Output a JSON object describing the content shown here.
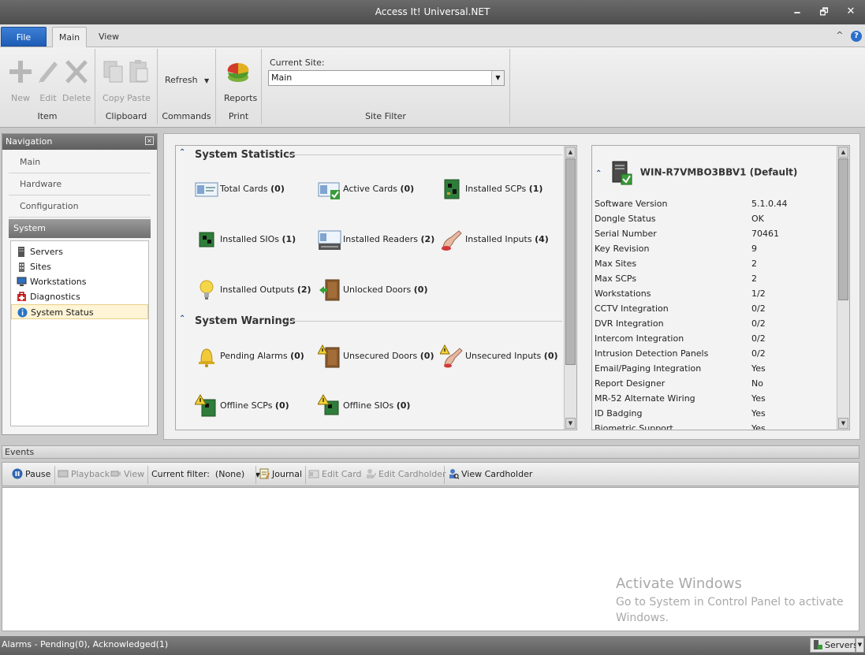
{
  "window": {
    "title": "Access It! Universal.NET",
    "controls": {
      "minimize": "🗕",
      "maximize": "🗗",
      "close": "✕"
    }
  },
  "ribbon": {
    "tabs": {
      "file": "File",
      "main": "Main",
      "view": "View"
    },
    "help_glyph": "?",
    "collapse_glyph": "^",
    "groups": {
      "item": {
        "label": "Item",
        "new": "New",
        "edit": "Edit",
        "delete": "Delete"
      },
      "clipboard": {
        "label": "Clipboard",
        "copy": "Copy",
        "paste": "Paste"
      },
      "commands": {
        "label": "Commands",
        "refresh": "Refresh"
      },
      "print": {
        "label": "Print",
        "reports": "Reports"
      },
      "site_filter": {
        "label": "Site Filter",
        "current_site_label": "Current Site:",
        "current_site_value": "Main"
      }
    }
  },
  "navigation": {
    "title": "Navigation",
    "sections": [
      "Main",
      "Hardware",
      "Configuration"
    ],
    "active_section": "System",
    "items": [
      {
        "label": "Servers",
        "icon": "server-icon"
      },
      {
        "label": "Sites",
        "icon": "site-icon"
      },
      {
        "label": "Workstations",
        "icon": "workstation-icon"
      },
      {
        "label": "Diagnostics",
        "icon": "diagnostics-icon"
      },
      {
        "label": "System Status",
        "icon": "info-icon",
        "selected": true
      }
    ]
  },
  "statistics": {
    "title": "System Statistics",
    "items": [
      {
        "label": "Total Cards",
        "count": "(0)"
      },
      {
        "label": "Active Cards",
        "count": "(0)"
      },
      {
        "label": "Installed SCPs",
        "count": "(1)"
      },
      {
        "label": "Installed SIOs",
        "count": "(1)"
      },
      {
        "label": "Installed Readers",
        "count": "(2)"
      },
      {
        "label": "Installed Inputs",
        "count": "(4)"
      },
      {
        "label": "Installed Outputs",
        "count": "(2)"
      },
      {
        "label": "Unlocked Doors",
        "count": "(0)"
      }
    ]
  },
  "warnings": {
    "title": "System Warnings",
    "items": [
      {
        "label": "Pending Alarms",
        "count": "(0)"
      },
      {
        "label": "Unsecured Doors",
        "count": "(0)"
      },
      {
        "label": "Unsecured Inputs",
        "count": "(0)"
      },
      {
        "label": "Offline SCPs",
        "count": "(0)"
      },
      {
        "label": "Offline SIOs",
        "count": "(0)"
      }
    ]
  },
  "server_info": {
    "name": "WIN-R7VMBO3BBV1 (Default)",
    "rows": [
      {
        "k": "Software Version",
        "v": "5.1.0.44"
      },
      {
        "k": "Dongle Status",
        "v": "OK"
      },
      {
        "k": "Serial Number",
        "v": "70461"
      },
      {
        "k": "Key Revision",
        "v": "9"
      },
      {
        "k": "Max Sites",
        "v": "2"
      },
      {
        "k": "Max SCPs",
        "v": "2"
      },
      {
        "k": "Workstations",
        "v": "1/2"
      },
      {
        "k": "CCTV Integration",
        "v": "0/2"
      },
      {
        "k": "DVR Integration",
        "v": "0/2"
      },
      {
        "k": "Intercom Integration",
        "v": "0/2"
      },
      {
        "k": "Intrusion Detection Panels",
        "v": "0/2"
      },
      {
        "k": "Email/Paging Integration",
        "v": "Yes"
      },
      {
        "k": "Report Designer",
        "v": "No"
      },
      {
        "k": "MR-52 Alternate Wiring",
        "v": "Yes"
      },
      {
        "k": "ID Badging",
        "v": "Yes"
      },
      {
        "k": "Biometric Support",
        "v": "Yes"
      }
    ]
  },
  "events": {
    "title": "Events",
    "toolbar": {
      "pause": "Pause",
      "playback": "Playback",
      "view": "View",
      "filter_label": "Current filter:",
      "filter_value": "(None)",
      "journal": "Journal",
      "edit_card": "Edit Card",
      "edit_cardholder": "Edit Cardholder",
      "view_cardholder": "View Cardholder"
    }
  },
  "watermark": {
    "line1": "Activate Windows",
    "line2": "Go to System in Control Panel to activate Windows."
  },
  "statusbar": {
    "alarms": "Alarms - Pending(0), Acknowledged(1)",
    "servers": "Servers"
  }
}
